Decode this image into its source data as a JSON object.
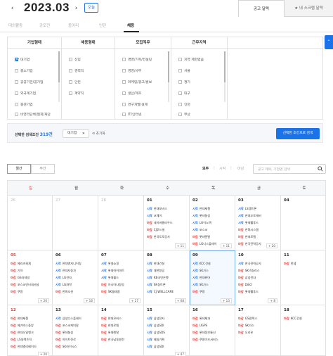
{
  "header": {
    "month": "2023.03",
    "prev_label": "‹",
    "next_label": "›",
    "today_label": "오늘",
    "view_tabs": [
      "공고 달력",
      "★ 내 스크랩 달력"
    ]
  },
  "categories": [
    "대외활동",
    "공모전",
    "동아리",
    "인턴",
    "채용"
  ],
  "filters": {
    "columns": [
      {
        "title": "기업형태",
        "items": [
          "대기업",
          "중소기업",
          "공공기관/공기업",
          "외국계기업",
          "중견기업",
          "비영리단체/협회/재단"
        ],
        "checked": [
          0
        ]
      },
      {
        "title": "채용형태",
        "items": [
          "신입",
          "경력직",
          "인턴",
          "계약직"
        ],
        "checked": []
      },
      {
        "title": "모집직무",
        "items": [
          "경영/기획/컨설팅",
          "경영/사무",
          "마케팅/광고/홍보",
          "생산/제조",
          "연구개발/설계",
          "IT/인터넷"
        ],
        "checked": []
      },
      {
        "title": "근무지역",
        "items": [
          "지역 제한없음",
          "서울",
          "경기",
          "대구",
          "인천",
          "부산"
        ],
        "checked": []
      }
    ]
  },
  "summary": {
    "label": "선택한 검색조건",
    "count": "319건",
    "chip": "대기업",
    "chip_close": "✕",
    "reset": "⟲ 초기화",
    "search_button": "선택한 조건으로 검색"
  },
  "controls": {
    "view_modes": [
      "월간",
      "주간"
    ],
    "filter_all": "모두",
    "filter_start": "시작",
    "filter_end": "마감",
    "divider": "|",
    "search_placeholder": "공고 제목, 기업명 검색"
  },
  "weekdays": [
    "일",
    "월",
    "화",
    "수",
    "목",
    "금",
    "토"
  ],
  "weeks": [
    [
      {
        "day": "26",
        "prev": true,
        "events": []
      },
      {
        "day": "27",
        "prev": true,
        "events": []
      },
      {
        "day": "28",
        "prev": true,
        "events": []
      },
      {
        "day": "01",
        "events": [
          [
            "시작",
            "현대모비스"
          ],
          [
            "시작",
            "코웨이"
          ],
          [
            "마감",
            "네이버클라우드"
          ],
          [
            "마감",
            "CJ푸드빌"
          ],
          [
            "마감",
            "한국도로공사"
          ]
        ],
        "more": "+ 11"
      },
      {
        "day": "02",
        "events": [
          [
            "시작",
            "현대제철"
          ],
          [
            "시작",
            "롯데칠성"
          ],
          [
            "시작",
            "LG이노텍"
          ],
          [
            "시작",
            "포스코"
          ],
          [
            "마감",
            "롯데렌탈"
          ],
          [
            "마감",
            "LG디스플레이"
          ]
        ],
        "more": "+ 11"
      },
      {
        "day": "03",
        "events": [
          [
            "시작",
            "LS엠트론"
          ],
          [
            "시작",
            "현대오토에버"
          ],
          [
            "시작",
            "롯데웰푸드"
          ],
          [
            "마감",
            "한화시스템"
          ],
          [
            "마감",
            "현대로템"
          ],
          [
            "마감",
            "한국전력공사"
          ]
        ],
        "more": "+ 20"
      },
      {
        "day": "04",
        "events": []
      }
    ],
    [
      {
        "day": "05",
        "sun": true,
        "events": [
          [
            "마감",
            "메리츠화재"
          ],
          [
            "마감",
            "기아"
          ],
          [
            "마감",
            "GS리테일"
          ],
          [
            "마감",
            "포스코인터내셔널"
          ],
          [
            "마감",
            "쿠팡"
          ]
        ],
        "more": "+ 26"
      },
      {
        "day": "06",
        "events": [
          [
            "시작",
            "현대엔지니어링"
          ],
          [
            "시작",
            "현대자동차"
          ],
          [
            "시작",
            "LG전자"
          ],
          [
            "시작",
            "LG화학"
          ],
          [
            "마감",
            "한화오션"
          ]
        ],
        "more": "+ 16"
      },
      {
        "day": "07",
        "events": [
          [
            "시작",
            "롯데쇼핑"
          ],
          [
            "시작",
            "롯데하이마트"
          ],
          [
            "시작",
            "롯데월드"
          ],
          [
            "마감",
            "아시아나항공"
          ],
          [
            "마감",
            "SK텔레콤"
          ]
        ],
        "more": "+ 27"
      },
      {
        "day": "08",
        "events": [
          [
            "시작",
            "현대건설"
          ],
          [
            "시작",
            "대한항공"
          ],
          [
            "시작",
            "KB국민은행"
          ],
          [
            "시작",
            "SK실트론"
          ],
          [
            "시작",
            "CJ WELLCARE"
          ]
        ],
        "more": "+ 68"
      },
      {
        "day": "09",
        "selected": true,
        "events": [
          [
            "시작",
            "KCC건설"
          ],
          [
            "시작",
            "SK가스"
          ],
          [
            "시작",
            "현대위아"
          ],
          [
            "시작",
            "SK가스"
          ],
          [
            "마감",
            "쿠팡"
          ]
        ],
        "more": "+ 13"
      },
      {
        "day": "10",
        "events": [
          [
            "시작",
            "한국전력공사"
          ],
          [
            "마감",
            "SK넥실리스"
          ],
          [
            "마감",
            "삼성전자"
          ],
          [
            "마감",
            "D&O"
          ],
          [
            "마감",
            "롯데웰푸드"
          ]
        ],
        "more": "+ 8"
      },
      {
        "day": "11",
        "events": [
          [
            "마감",
            "한샘"
          ]
        ]
      }
    ],
    [
      {
        "day": "12",
        "sun": true,
        "events": [
          [
            "마감",
            "현대제철"
          ],
          [
            "마감",
            "메가박스중앙"
          ],
          [
            "마감",
            "현대오일뱅크"
          ],
          [
            "마감",
            "LS일렉트릭"
          ],
          [
            "마감",
            "현대엘리베이터"
          ]
        ],
        "more": "+ 20"
      },
      {
        "day": "13",
        "events": [
          [
            "시작",
            "삼성디스플레이"
          ],
          [
            "마감",
            "포스코케미칼"
          ],
          [
            "마감",
            "롯데칠성"
          ],
          [
            "마감",
            "하이트진로"
          ],
          [
            "마감",
            "SK하이닉스"
          ]
        ]
      },
      {
        "day": "14",
        "events": [
          [
            "마감",
            "현대모비스"
          ],
          [
            "마감",
            "현대로템"
          ],
          [
            "마감",
            "롯데렌탈"
          ],
          [
            "마감",
            "한국남동발전"
          ]
        ]
      },
      {
        "day": "15",
        "events": [
          [
            "시작",
            "삼성전자"
          ],
          [
            "시작",
            "삼성SDI"
          ],
          [
            "시작",
            "삼성SDS"
          ],
          [
            "시작",
            "제일기획"
          ],
          [
            "시작",
            "삼성SDI"
          ]
        ],
        "more": "+ 47"
      },
      {
        "day": "16",
        "events": [
          [
            "마감",
            "롯데제과"
          ],
          [
            "마감",
            "UGPS"
          ],
          [
            "마감",
            "롯데정보통신"
          ],
          [
            "마감",
            "쿠팡이츠서비스"
          ]
        ]
      },
      {
        "day": "17",
        "events": [
          [
            "마감",
            "GS칼텍스"
          ],
          [
            "마감",
            "SK가스"
          ],
          [
            "마감",
            "오리온"
          ]
        ]
      },
      {
        "day": "18",
        "events": [
          [
            "마감",
            "KCC건설"
          ]
        ]
      }
    ]
  ]
}
